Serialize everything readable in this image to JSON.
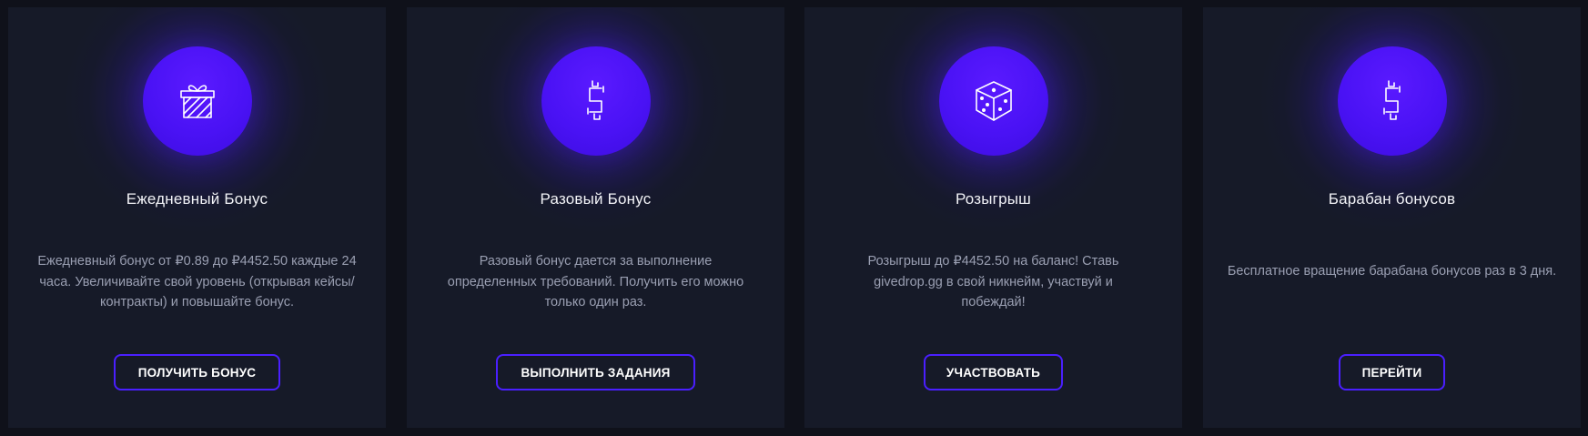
{
  "cards": [
    {
      "icon": "gift-icon",
      "title": "Ежедневный Бонус",
      "description": "Ежедневный бонус от ₽0.89 до ₽4452.50 каждые 24 часа. Увеличивайте свой уровень (открывая кейсы/контракты) и повышайте бонус.",
      "button": "ПОЛУЧИТЬ БОНУС"
    },
    {
      "icon": "dollar-icon",
      "title": "Разовый Бонус",
      "description": "Разовый бонус дается за выполнение определенных требований. Получить его можно только один раз.",
      "button": "ВЫПОЛНИТЬ ЗАДАНИЯ"
    },
    {
      "icon": "dice-icon",
      "title": "Розыгрыш",
      "description": "Розыгрыш до ₽4452.50 на баланс! Ставь givedrop.gg в свой никнейм, участвуй и побеждай!",
      "button": "УЧАСТВОВАТЬ"
    },
    {
      "icon": "dollar-icon",
      "title": "Барабан бонусов",
      "description": "Бесплатное вращение барабана бонусов раз в 3 дня.",
      "button": "ПЕРЕЙТИ"
    }
  ],
  "colors": {
    "page_background": "#0f111a",
    "card_background": "#161a28",
    "accent": "#4a1fff",
    "title_text": "#f2f3f7",
    "description_text": "#9a9fb2"
  }
}
